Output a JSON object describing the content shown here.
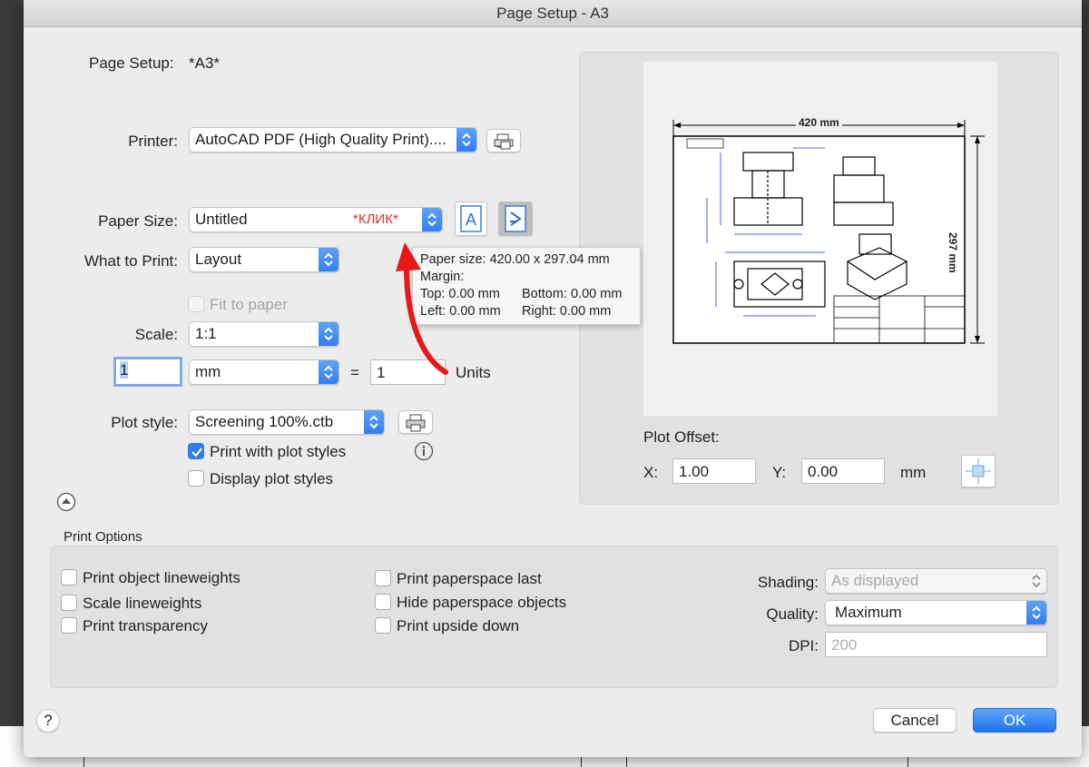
{
  "window": {
    "title": "Page Setup - A3"
  },
  "page_setup": {
    "label": "Page Setup:",
    "value": "*A3*"
  },
  "printer": {
    "label": "Printer:",
    "value": "AutoCAD PDF (High Quality Print)...."
  },
  "paper_size": {
    "label": "Paper Size:",
    "value": "Untitled",
    "annotation": "*КЛИК*"
  },
  "what_to_print": {
    "label": "What to Print:",
    "value": "Layout"
  },
  "fit_to_paper": {
    "label": "Fit to paper",
    "checked": false,
    "enabled": false
  },
  "scale": {
    "label": "Scale:",
    "value": "1:1",
    "units_value": "1",
    "unit": "mm",
    "equals": "=",
    "paper_value": "1",
    "units_label": "Units"
  },
  "plot_style": {
    "label": "Plot style:",
    "value": "Screening 100%.ctb"
  },
  "print_with_plot_styles": {
    "label": "Print with plot styles",
    "checked": true
  },
  "display_plot_styles": {
    "label": "Display plot styles",
    "checked": false
  },
  "tooltip": {
    "paper_size": "Paper size: 420.00 x 297.04 mm",
    "margin": "Margin:",
    "top": "Top: 0.00 mm",
    "bottom": "Bottom: 0.00 mm",
    "left": "Left: 0.00 mm",
    "right": "Right: 0.00 mm"
  },
  "preview": {
    "width_dim": "420 mm",
    "height_dim": "297 mm"
  },
  "plot_offset": {
    "label": "Plot Offset:",
    "x_label": "X:",
    "x_value": "1.00",
    "y_label": "Y:",
    "y_value": "0.00",
    "unit": "mm"
  },
  "print_options": {
    "title": "Print Options",
    "col1": [
      {
        "label": "Print object lineweights",
        "checked": false
      },
      {
        "label": "Scale lineweights",
        "checked": false
      },
      {
        "label": "Print transparency",
        "checked": false
      }
    ],
    "col2": [
      {
        "label": "Print paperspace last",
        "checked": false
      },
      {
        "label": "Hide paperspace objects",
        "checked": false
      },
      {
        "label": "Print upside down",
        "checked": false
      }
    ],
    "shading": {
      "label": "Shading:",
      "value": "As displayed"
    },
    "quality": {
      "label": "Quality:",
      "value": "Maximum"
    },
    "dpi": {
      "label": "DPI:",
      "value": "200"
    }
  },
  "buttons": {
    "help": "?",
    "cancel": "Cancel",
    "ok": "OK"
  },
  "colors": {
    "accent": "#2f7cf0",
    "annotation": "#f02a2a"
  }
}
